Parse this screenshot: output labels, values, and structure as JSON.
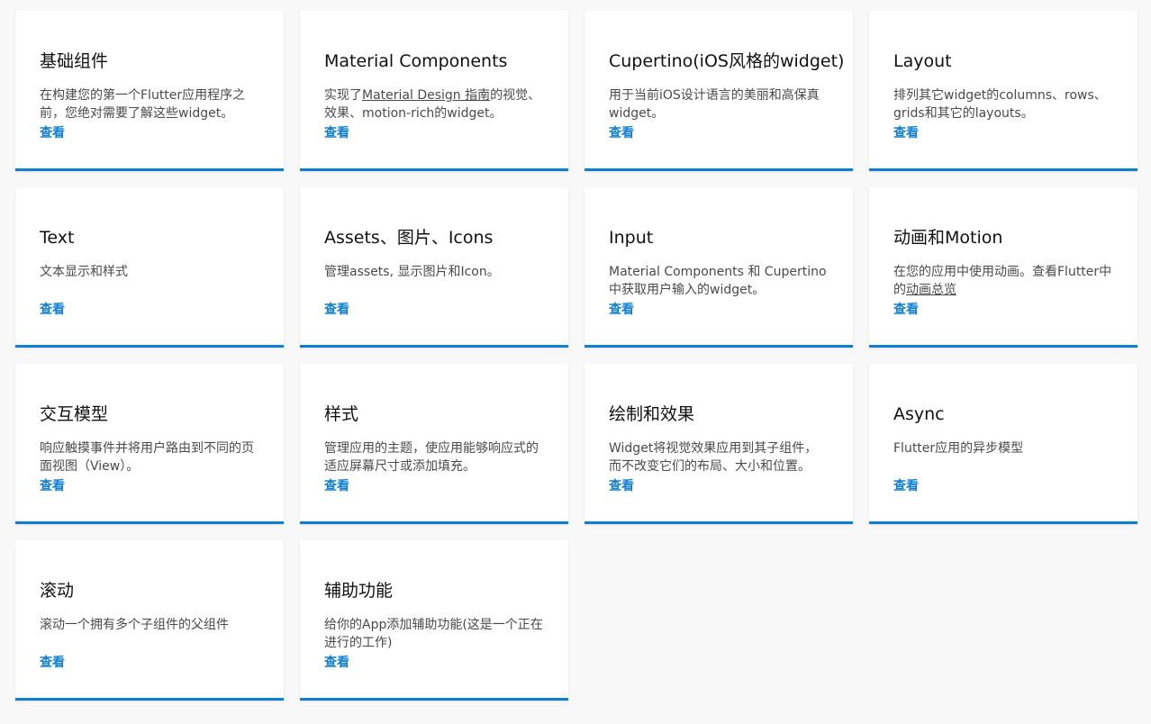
{
  "cards": [
    {
      "title": "基础组件",
      "desc": "在构建您的第一个Flutter应用程序之前，您绝对需要了解这些widget。",
      "link": "查看"
    },
    {
      "title": "Material Components",
      "desc_pre": "实现了",
      "desc_link": "Material Design 指南",
      "desc_post": "的视觉、效果、motion-rich的widget。",
      "link": "查看"
    },
    {
      "title": "Cupertino(iOS风格的widget)",
      "desc": "用于当前iOS设计语言的美丽和高保真widget。",
      "link": "查看"
    },
    {
      "title": "Layout",
      "desc": "排列其它widget的columns、rows、grids和其它的layouts。",
      "link": "查看"
    },
    {
      "title": "Text",
      "desc": "文本显示和样式",
      "link": "查看"
    },
    {
      "title": "Assets、图片、Icons",
      "desc": "管理assets, 显示图片和Icon。",
      "link": "查看"
    },
    {
      "title": "Input",
      "desc": "Material Components 和 Cupertino中获取用户输入的widget。",
      "link": "查看"
    },
    {
      "title": "动画和Motion",
      "desc_pre": "在您的应用中使用动画。查看Flutter中的",
      "desc_link": "动画总览",
      "desc_post": "",
      "link": "查看"
    },
    {
      "title": "交互模型",
      "desc": "响应触摸事件并将用户路由到不同的页面视图（View）。",
      "link": "查看"
    },
    {
      "title": "样式",
      "desc": "管理应用的主题，使应用能够响应式的适应屏幕尺寸或添加填充。",
      "link": "查看"
    },
    {
      "title": "绘制和效果",
      "desc": "Widget将视觉效果应用到其子组件，而不改变它们的布局、大小和位置。",
      "link": "查看"
    },
    {
      "title": "Async",
      "desc": "Flutter应用的异步模型",
      "link": "查看"
    },
    {
      "title": "滚动",
      "desc": "滚动一个拥有多个子组件的父组件",
      "link": "查看"
    },
    {
      "title": "辅助功能",
      "desc": "给你的App添加辅助功能(这是一个正在进行的工作)",
      "link": "查看"
    }
  ]
}
